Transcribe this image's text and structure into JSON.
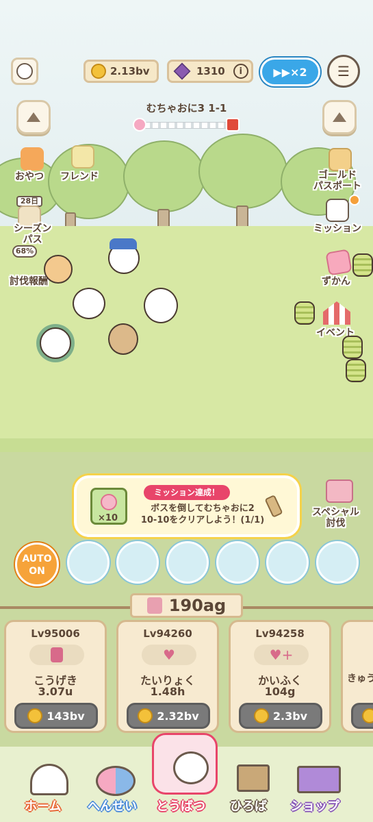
{
  "currency": {
    "gold": "2.13bv",
    "gems": "1310"
  },
  "speed": "▶▶×2",
  "stage": {
    "title": "むちゃおに3 1-1"
  },
  "left_menu": {
    "snack": "おやつ",
    "friend": "フレンド",
    "season_days": "28日",
    "season_pass_line1": "シーズン",
    "season_pass_line2": "パス",
    "reward_pct": "68%",
    "reward": "討伐報酬"
  },
  "right_menu": {
    "gold_pass_line1": "ゴールド",
    "gold_pass_line2": "パスポート",
    "mission": "ミッション",
    "zukan": "ずかん",
    "event": "イベント"
  },
  "mission": {
    "badge": "ミッション達成！",
    "text_line1": "ボスを倒してむちゃおに2",
    "text_line2": "10-10をクリアしよう！(1/1)",
    "multiplier": "×10"
  },
  "special": {
    "line1": "スペシャル",
    "line2": "討伐"
  },
  "auto": {
    "line1": "AUTO",
    "line2": "ON"
  },
  "attack_power": "190ag",
  "cards": [
    {
      "level": "Lv95006",
      "name": "こうげき",
      "value": "3.07u",
      "cost": "143bv"
    },
    {
      "level": "Lv94260",
      "name": "たいりょく",
      "value": "1.48h",
      "cost": "2.32bv"
    },
    {
      "level": "Lv94258",
      "name": "かいふく",
      "value": "104g",
      "cost": "2.3bv"
    },
    {
      "level": "",
      "name": "きゅう",
      "value": "",
      "cost": ""
    }
  ],
  "nav": {
    "home": "ホーム",
    "formation": "へんせい",
    "battle": "とうばつ",
    "plaza": "ひろば",
    "shop": "ショップ"
  },
  "colors": {
    "accent_blue": "#3aa7e8",
    "gold": "#f3c13a",
    "nav_outline": "#e8456a"
  }
}
